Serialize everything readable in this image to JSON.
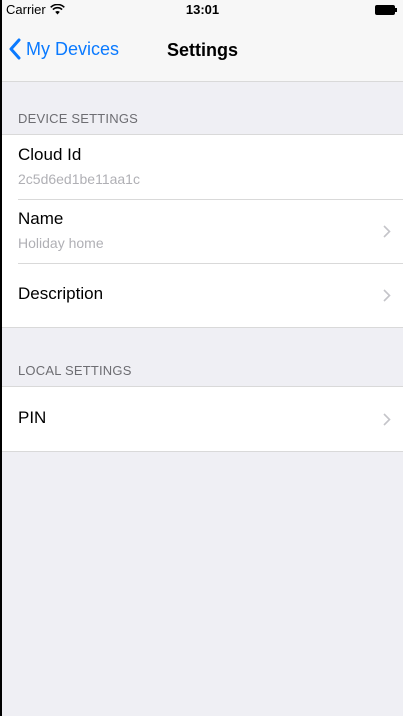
{
  "status_bar": {
    "carrier": "Carrier",
    "time": "13:01"
  },
  "nav": {
    "back_label": "My Devices",
    "title": "Settings"
  },
  "sections": [
    {
      "header": "DEVICE SETTINGS",
      "cells": [
        {
          "title": "Cloud Id",
          "subtitle": "2c5d6ed1be11aa1c",
          "disclosure": false
        },
        {
          "title": "Name",
          "subtitle": "Holiday home",
          "disclosure": true
        },
        {
          "title": "Description",
          "subtitle": "",
          "disclosure": true
        }
      ]
    },
    {
      "header": "LOCAL SETTINGS",
      "cells": [
        {
          "title": "PIN",
          "subtitle": "",
          "disclosure": true
        }
      ]
    }
  ],
  "colors": {
    "accent": "#0a7aff",
    "background": "#efeff4",
    "secondary_text": "#b0b0b5",
    "section_header_text": "#6d6d72"
  },
  "icons": {
    "wifi": "wifi-icon",
    "battery": "battery-icon",
    "back": "chevron-left-icon",
    "disclosure": "chevron-right-icon"
  }
}
